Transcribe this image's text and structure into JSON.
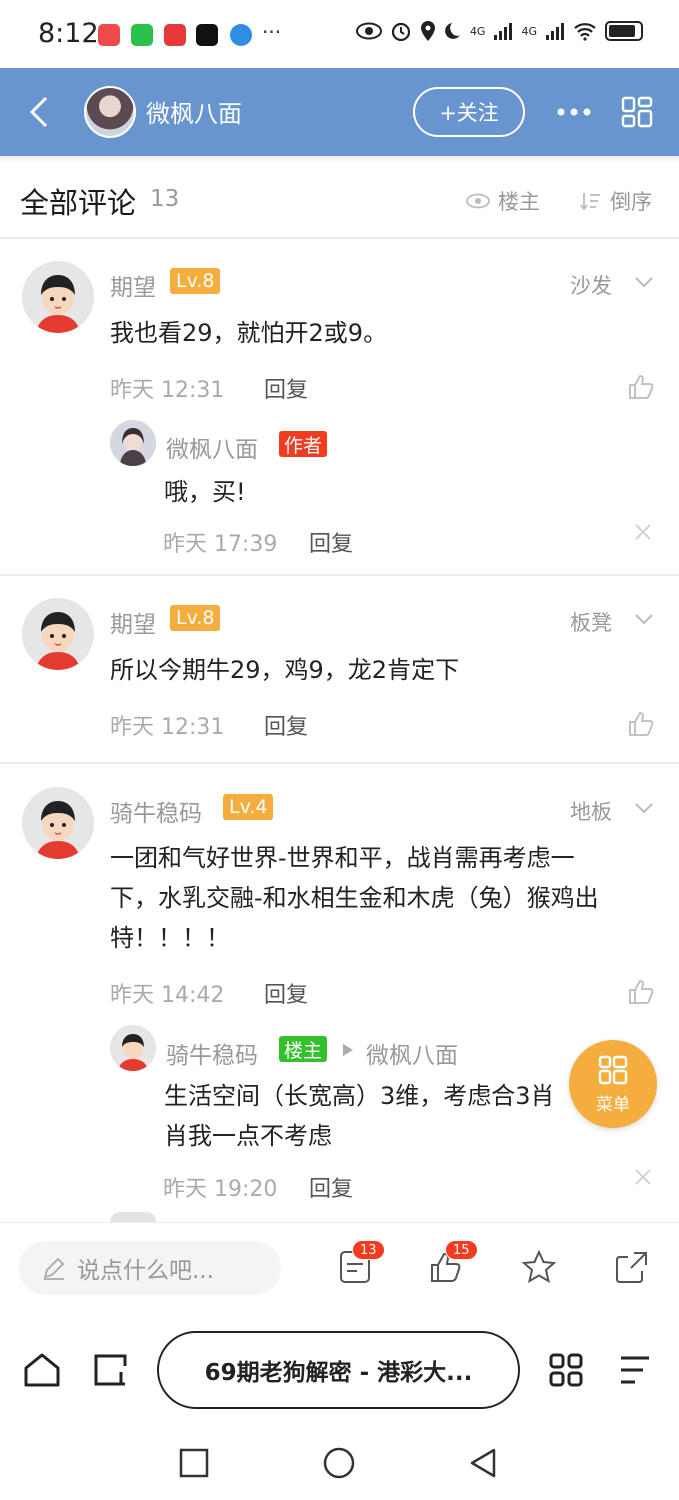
{
  "status_bar": {
    "time": "8:12",
    "more": "···",
    "net1": "4G",
    "net2": "4G"
  },
  "header": {
    "user_name": "微枫八面",
    "follow_label": "+关注",
    "back_icon": "chevron-left-icon",
    "more_icon": "more-dots-icon",
    "grid_icon": "grid-icon"
  },
  "comments_bar": {
    "title": "全部评论",
    "count": "13",
    "louzhu_label": "楼主",
    "order_label": "倒序"
  },
  "comments": [
    {
      "user": "期望",
      "level": "Lv.8",
      "floor": "沙发",
      "text": "我也看29，就怕开2或9。",
      "time": "昨天 12:31",
      "reply_label": "回复",
      "sub": {
        "user": "微枫八面",
        "tag": "作者",
        "text": "哦，买!",
        "time": "昨天 17:39",
        "reply_label": "回复"
      }
    },
    {
      "user": "期望",
      "level": "Lv.8",
      "floor": "板凳",
      "text": "所以今期牛29，鸡9，龙2肯定下",
      "time": "昨天 12:31",
      "reply_label": "回复"
    },
    {
      "user": "骑牛稳码",
      "level": "Lv.4",
      "floor": "地板",
      "text_lines": [
        "一团和气好世界-世界和平，战肖需再考虑一",
        "下，水乳交融-和水相生金和木虎（兔）猴鸡出",
        "特！！！！"
      ],
      "time": "昨天 14:42",
      "reply_label": "回复",
      "sub": {
        "user": "骑牛稳码",
        "tag": "楼主",
        "reply_to": "微枫八面",
        "text_lines": [
          "生活空间（长宽高）3维，考虑合3肖",
          "肖我一点不考虑"
        ],
        "time": "昨天 19:20",
        "reply_label": "回复"
      }
    }
  ],
  "menu_fab": {
    "label": "菜单"
  },
  "input_bar": {
    "placeholder": "说点什么吧...",
    "comment_badge": "13",
    "like_badge": "15"
  },
  "browser": {
    "url_title": "69期老狗解密 - 港彩大..."
  },
  "colors": {
    "header_bg": "#6895cf",
    "level_badge": "#f5ad3e",
    "author_tag": "#f23b1f",
    "louzhu_tag": "#34c02b",
    "badge_red": "#f23b1f"
  }
}
